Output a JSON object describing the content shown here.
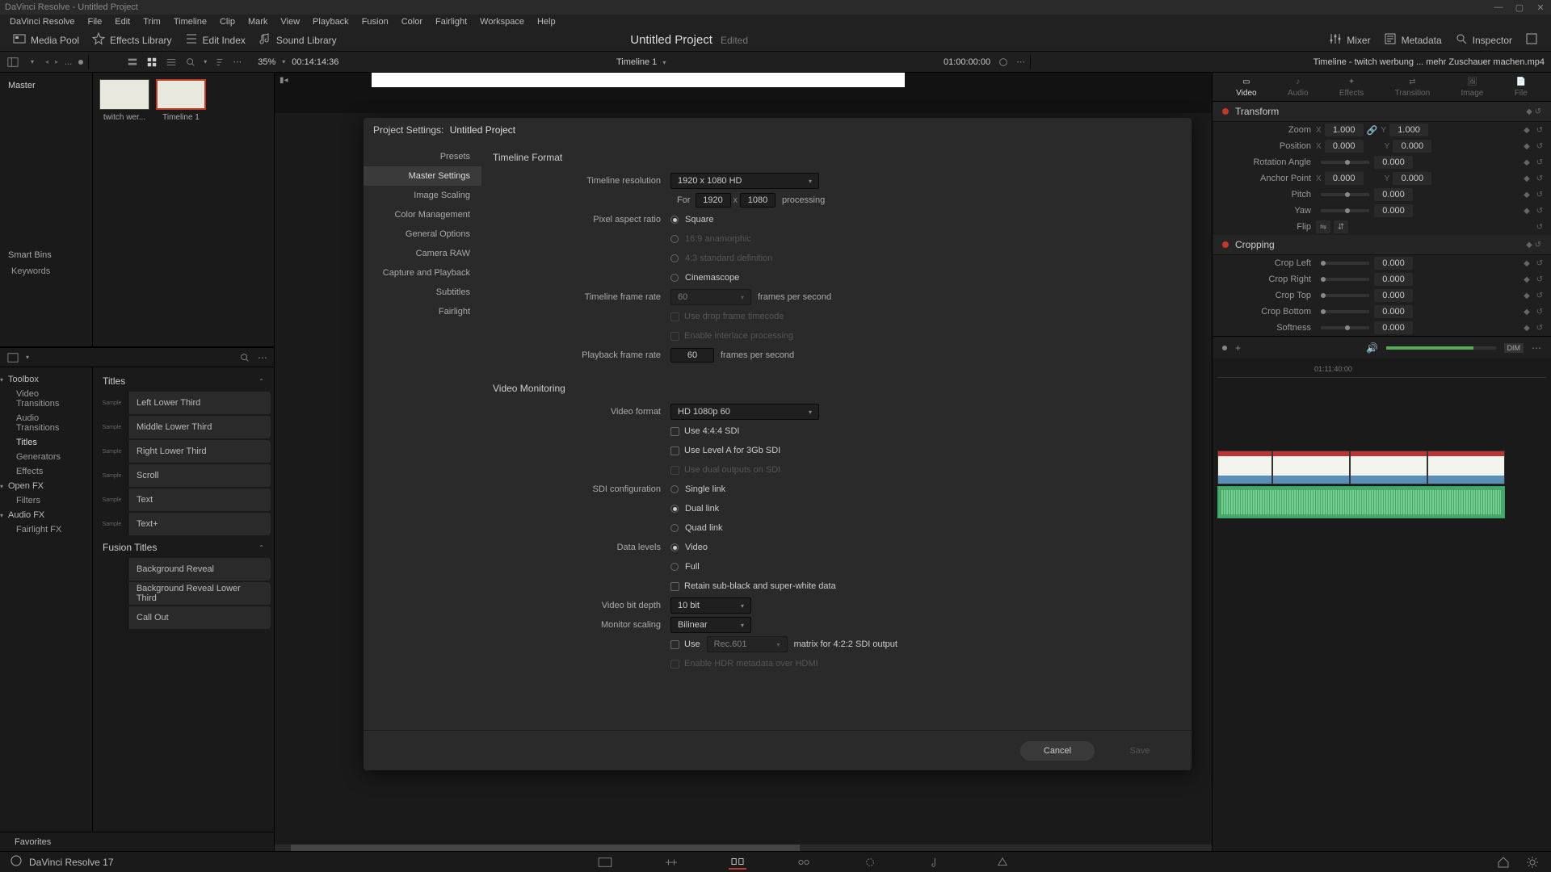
{
  "app": {
    "title": "DaVinci Resolve - Untitled Project",
    "version": "DaVinci Resolve 17"
  },
  "menus": [
    "DaVinci Resolve",
    "File",
    "Edit",
    "Trim",
    "Timeline",
    "Clip",
    "Mark",
    "View",
    "Playback",
    "Fusion",
    "Color",
    "Fairlight",
    "Workspace",
    "Help"
  ],
  "toolbar": {
    "media_pool": "Media Pool",
    "effects_library": "Effects Library",
    "edit_index": "Edit Index",
    "sound_library": "Sound Library",
    "project_title": "Untitled Project",
    "project_status": "Edited",
    "mixer": "Mixer",
    "metadata": "Metadata",
    "inspector": "Inspector"
  },
  "subbar": {
    "zoom_pct": "35%",
    "tc_left": "00:14:14:36",
    "timeline_name": "Timeline 1",
    "tc_right": "01:00:00:00",
    "inspector_clip": "Timeline - twitch werbung ... mehr Zuschauer machen.mp4"
  },
  "bins": {
    "master": "Master",
    "smart_bins": "Smart Bins",
    "keywords": "Keywords",
    "clips": [
      {
        "label": "twitch wer...",
        "selected": false
      },
      {
        "label": "Timeline 1",
        "selected": true
      }
    ]
  },
  "fx": {
    "cats": [
      {
        "label": "Toolbox",
        "hdr": true
      },
      {
        "label": "Video Transitions"
      },
      {
        "label": "Audio Transitions"
      },
      {
        "label": "Titles",
        "selected": true
      },
      {
        "label": "Generators"
      },
      {
        "label": "Effects"
      },
      {
        "label": "Open FX",
        "hdr": true
      },
      {
        "label": "Filters"
      },
      {
        "label": "Audio FX",
        "hdr": true
      },
      {
        "label": "Fairlight FX"
      }
    ],
    "group_titles": "Titles",
    "titles": [
      "Left Lower Third",
      "Middle Lower Third",
      "Right Lower Third",
      "Scroll",
      "Text",
      "Text+"
    ],
    "group_fusion": "Fusion Titles",
    "fusion": [
      "Background Reveal",
      "Background Reveal Lower Third",
      "Call Out"
    ],
    "favorites": "Favorites"
  },
  "inspector": {
    "tabs": [
      "Video",
      "Audio",
      "Effects",
      "Transition",
      "Image",
      "File"
    ],
    "active": 0,
    "transform": {
      "title": "Transform",
      "zoom": {
        "x": "1.000",
        "y": "1.000"
      },
      "position": {
        "x": "0.000",
        "y": "0.000"
      },
      "rotation": "0.000",
      "anchor": {
        "x": "0.000",
        "y": "0.000"
      },
      "pitch": "0.000",
      "yaw": "0.000",
      "flip": "Flip",
      "labels": {
        "zoom": "Zoom",
        "position": "Position",
        "rotation": "Rotation Angle",
        "anchor": "Anchor Point",
        "pitch": "Pitch",
        "yaw": "Yaw"
      }
    },
    "cropping": {
      "title": "Cropping",
      "left": "0.000",
      "right": "0.000",
      "top": "0.000",
      "bottom": "0.000",
      "softness": "0.000",
      "labels": {
        "left": "Crop Left",
        "right": "Crop Right",
        "top": "Crop Top",
        "bottom": "Crop Bottom",
        "softness": "Softness"
      }
    },
    "dim": "DIM",
    "mini_tc": "01:11:40:00"
  },
  "modal": {
    "title": "Project Settings:",
    "project": "Untitled Project",
    "nav": [
      "Presets",
      "Master Settings",
      "Image Scaling",
      "Color Management",
      "General Options",
      "Camera RAW",
      "Capture and Playback",
      "Subtitles",
      "Fairlight"
    ],
    "nav_active": 1,
    "timeline_format": {
      "title": "Timeline Format",
      "resolution_label": "Timeline resolution",
      "resolution_value": "1920 x 1080 HD",
      "for": "For",
      "w": "1920",
      "h": "1080",
      "processing": "processing",
      "par_label": "Pixel aspect ratio",
      "par_opts": [
        "Square",
        "16:9 anamorphic",
        "4:3 standard definition",
        "Cinemascope"
      ],
      "fps_label": "Timeline frame rate",
      "fps": "60",
      "fps_unit": "frames per second",
      "drop": "Use drop frame timecode",
      "interlace": "Enable interlace processing",
      "pfps_label": "Playback frame rate",
      "pfps": "60"
    },
    "video_monitoring": {
      "title": "Video Monitoring",
      "vf_label": "Video format",
      "vf_value": "HD 1080p 60",
      "use_444": "Use 4:4:4 SDI",
      "use_levela": "Use Level A for 3Gb SDI",
      "dual_out": "Use dual outputs on SDI",
      "sdi_label": "SDI configuration",
      "sdi_opts": [
        "Single link",
        "Dual link",
        "Quad link"
      ],
      "data_label": "Data levels",
      "data_opts": [
        "Video",
        "Full"
      ],
      "retain": "Retain sub-black and super-white data",
      "bit_label": "Video bit depth",
      "bit_value": "10 bit",
      "scale_label": "Monitor scaling",
      "scale_value": "Bilinear",
      "matrix_use": "Use",
      "matrix_opt": "Rec.601",
      "matrix_txt": "matrix for 4:2:2 SDI output",
      "hdr": "Enable HDR metadata over HDMI"
    },
    "cancel": "Cancel",
    "save": "Save"
  }
}
